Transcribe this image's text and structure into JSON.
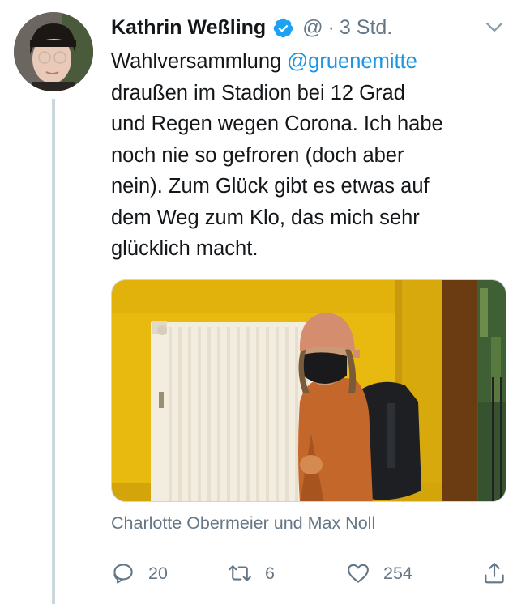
{
  "author": {
    "display_name": "Kathrin Weßling",
    "handle": "@",
    "separator": "·",
    "time": "3 Std."
  },
  "tweet": {
    "line1_text": "Wahlversammlung ",
    "mention": "@gruenemitte",
    "lines": [
      "draußen im Stadion bei 12 Grad",
      "und Regen wegen Corona. Ich habe",
      "noch nie so gefroren (doch aber",
      "nein). Zum Glück gibt es etwas auf",
      "dem Weg zum Klo, das mich sehr",
      "glücklich macht."
    ]
  },
  "tagged_people": "Charlotte Obermeier und Max Noll",
  "actions": {
    "replies": "20",
    "retweets": "6",
    "likes": "254"
  },
  "colors": {
    "accent": "#1da1f2",
    "mention": "#1b95e0",
    "muted": "#657786",
    "thread_line": "#ccd6dd"
  },
  "icons": [
    "verified-badge-icon",
    "chevron-down-icon",
    "reply-icon",
    "retweet-icon",
    "like-icon",
    "share-icon"
  ]
}
